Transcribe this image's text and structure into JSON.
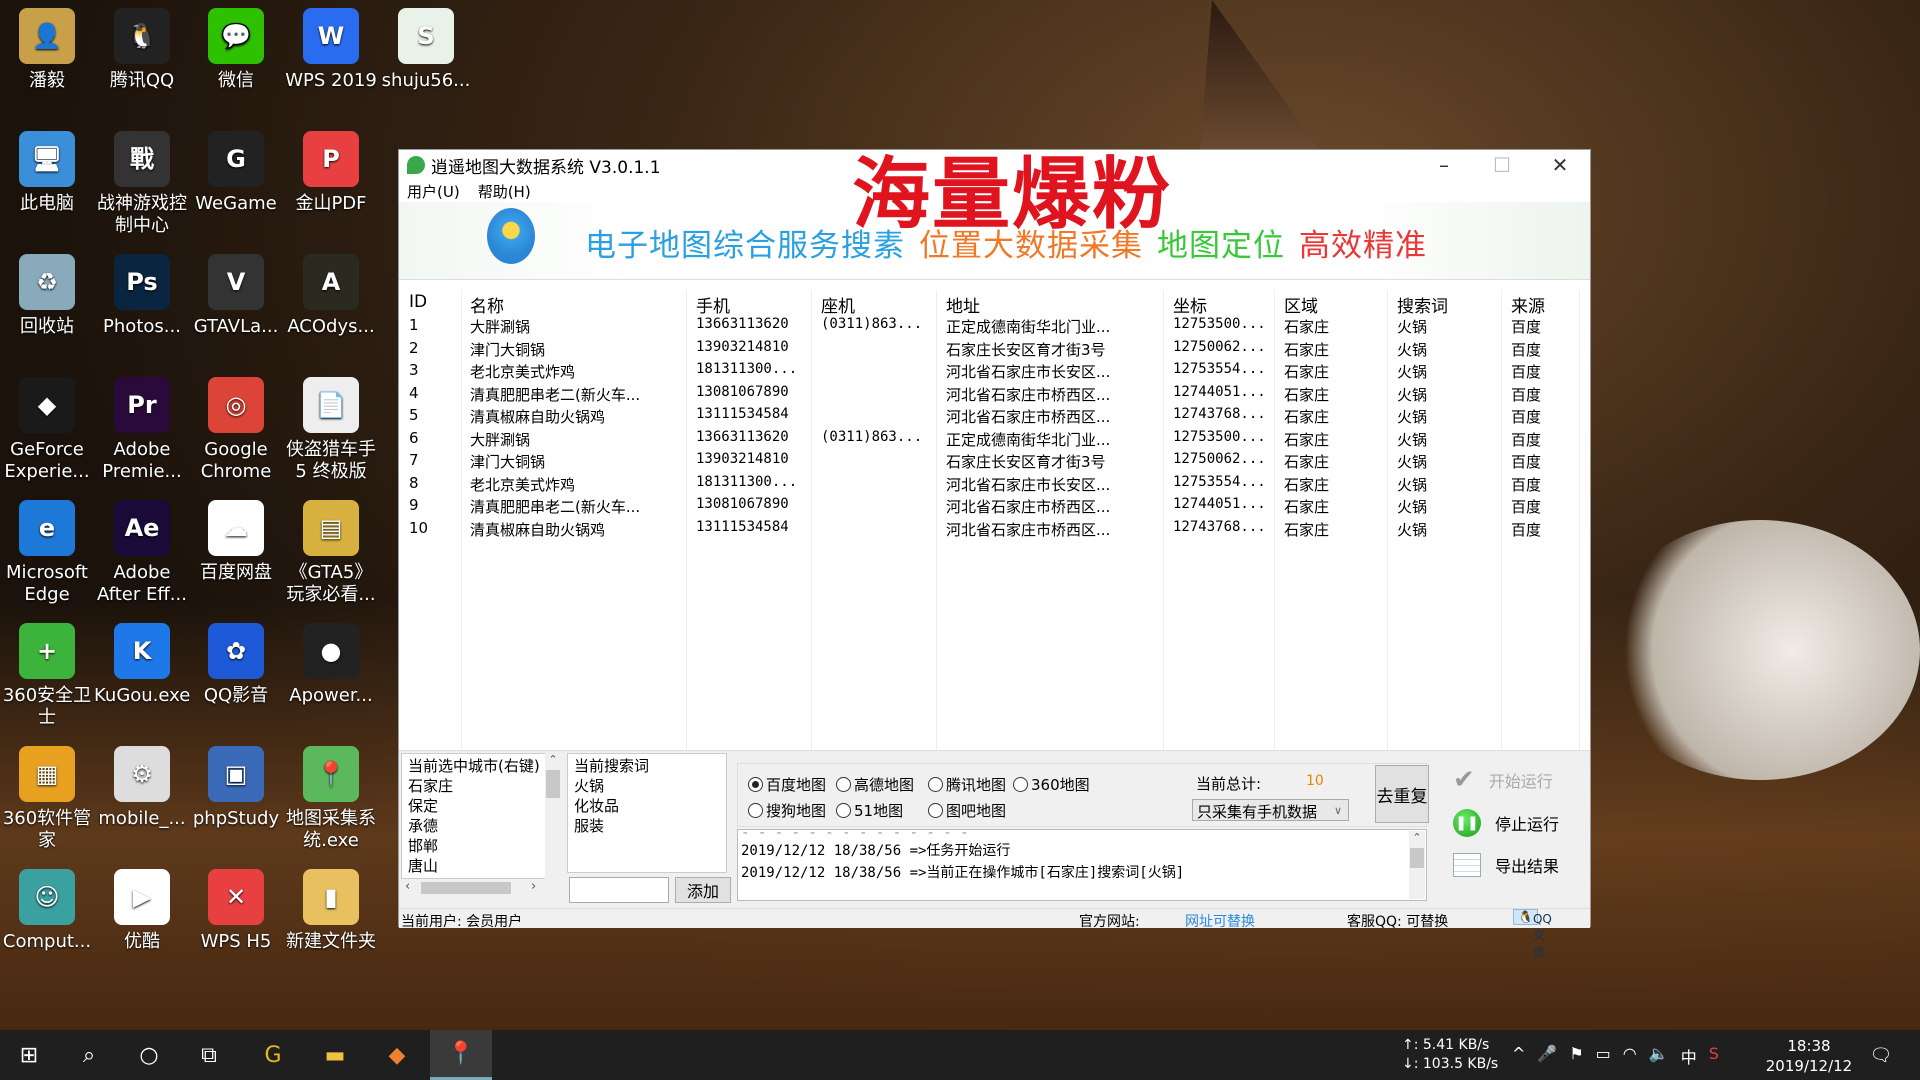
{
  "desktop_icons": [
    {
      "label": "潘毅",
      "color": "#c9a04a",
      "glyph": "👤"
    },
    {
      "label": "腾讯QQ",
      "color": "#222",
      "glyph": "🐧"
    },
    {
      "label": "微信",
      "color": "#2dc100",
      "glyph": "💬"
    },
    {
      "label": "WPS 2019",
      "color": "#2a6cf0",
      "glyph": "W"
    },
    {
      "label": "shuju56...",
      "color": "#e8f2e8",
      "glyph": "S"
    },
    {
      "label": "此电脑",
      "color": "#3a8fd8",
      "glyph": "🖥"
    },
    {
      "label": "战神游戏控制中心",
      "color": "#333",
      "glyph": "戰"
    },
    {
      "label": "WeGame",
      "color": "#222",
      "glyph": "G"
    },
    {
      "label": "金山PDF",
      "color": "#e84040",
      "glyph": "P"
    },
    {
      "label": "",
      "color": "",
      "glyph": ""
    },
    {
      "label": "回收站",
      "color": "#8ab",
      "glyph": "♻"
    },
    {
      "label": "Photos...",
      "color": "#0a2540",
      "glyph": "Ps"
    },
    {
      "label": "GTAVLa...",
      "color": "#333",
      "glyph": "V"
    },
    {
      "label": "ACOdys...",
      "color": "#2a2a20",
      "glyph": "A"
    },
    {
      "label": "",
      "color": "",
      "glyph": ""
    },
    {
      "label": "GeForce Experie...",
      "color": "#1a1a1a",
      "glyph": "◆"
    },
    {
      "label": "Adobe Premie...",
      "color": "#2a0a3a",
      "glyph": "Pr"
    },
    {
      "label": "Google Chrome",
      "color": "#db4437",
      "glyph": "◎"
    },
    {
      "label": "侠盗猎车手5 终极版",
      "color": "#eee",
      "glyph": "📄"
    },
    {
      "label": "",
      "color": "",
      "glyph": ""
    },
    {
      "label": "Microsoft Edge",
      "color": "#1e78d8",
      "glyph": "e"
    },
    {
      "label": "Adobe After Eff...",
      "color": "#1a0a3a",
      "glyph": "Ae"
    },
    {
      "label": "百度网盘",
      "color": "#fff",
      "glyph": "☁"
    },
    {
      "label": "《GTA5》玩家必看...",
      "color": "#d8b040",
      "glyph": "▤"
    },
    {
      "label": "",
      "color": "",
      "glyph": ""
    },
    {
      "label": "360安全卫士",
      "color": "#3cb43c",
      "glyph": "+"
    },
    {
      "label": "KuGou.exe",
      "color": "#1e78e8",
      "glyph": "K"
    },
    {
      "label": "QQ影音",
      "color": "#1e5ad8",
      "glyph": "✿"
    },
    {
      "label": "Apower...",
      "color": "#222",
      "glyph": "●"
    },
    {
      "label": "",
      "color": "",
      "glyph": ""
    },
    {
      "label": "360软件管家",
      "color": "#e8a020",
      "glyph": "▦"
    },
    {
      "label": "mobile_...",
      "color": "#ddd",
      "glyph": "⚙"
    },
    {
      "label": "phpStudy",
      "color": "#3a6ab8",
      "glyph": "▣"
    },
    {
      "label": "地图采集系统.exe",
      "color": "#5cb85c",
      "glyph": "📍"
    },
    {
      "label": "",
      "color": "",
      "glyph": ""
    },
    {
      "label": "Comput...",
      "color": "#3aa0a0",
      "glyph": "☺"
    },
    {
      "label": "优酷",
      "color": "#fff",
      "glyph": "▶"
    },
    {
      "label": "WPS H5",
      "color": "#e84040",
      "glyph": "✕"
    },
    {
      "label": "新建文件夹",
      "color": "#e8c060",
      "glyph": "▮"
    },
    {
      "label": "",
      "color": "",
      "glyph": ""
    }
  ],
  "window": {
    "title": "逍遥地图大数据系统 V3.0.1.1",
    "menu": [
      "用户(U)",
      "帮助(H)"
    ],
    "overlay_text": "海量爆粉",
    "slogans": [
      {
        "text": "电子地图综合服务搜素",
        "color": "#2aa0e0"
      },
      {
        "text": "位置大数据采集",
        "color": "#f07828"
      },
      {
        "text": "地图定位",
        "color": "#38c838"
      },
      {
        "text": "高效精准",
        "color": "#e83838"
      }
    ]
  },
  "table": {
    "columns": [
      "ID",
      "名称",
      "手机",
      "座机",
      "地址",
      "坐标",
      "区域",
      "搜索词",
      "来源"
    ],
    "rows": [
      [
        "1",
        "大胖涮锅",
        "13663113620",
        "(0311)863...",
        "正定成德南街华北门业...",
        "12753500...",
        "石家庄",
        "火锅",
        "百度"
      ],
      [
        "2",
        "津门大铜锅",
        "13903214810",
        "",
        "石家庄长安区育才街3号",
        "12750062...",
        "石家庄",
        "火锅",
        "百度"
      ],
      [
        "3",
        "老北京美式炸鸡",
        "181311300...",
        "",
        "河北省石家庄市长安区...",
        "12753554...",
        "石家庄",
        "火锅",
        "百度"
      ],
      [
        "4",
        "清真肥肥串老二(新火车...",
        "13081067890",
        "",
        "河北省石家庄市桥西区...",
        "12744051...",
        "石家庄",
        "火锅",
        "百度"
      ],
      [
        "5",
        "清真椒麻自助火锅鸡",
        "13111534584",
        "",
        "河北省石家庄市桥西区...",
        "12743768...",
        "石家庄",
        "火锅",
        "百度"
      ],
      [
        "6",
        "大胖涮锅",
        "13663113620",
        "(0311)863...",
        "正定成德南街华北门业...",
        "12753500...",
        "石家庄",
        "火锅",
        "百度"
      ],
      [
        "7",
        "津门大铜锅",
        "13903214810",
        "",
        "石家庄长安区育才街3号",
        "12750062...",
        "石家庄",
        "火锅",
        "百度"
      ],
      [
        "8",
        "老北京美式炸鸡",
        "181311300...",
        "",
        "河北省石家庄市长安区...",
        "12753554...",
        "石家庄",
        "火锅",
        "百度"
      ],
      [
        "9",
        "清真肥肥串老二(新火车...",
        "13081067890",
        "",
        "河北省石家庄市桥西区...",
        "12744051...",
        "石家庄",
        "火锅",
        "百度"
      ],
      [
        "10",
        "清真椒麻自助火锅鸡",
        "13111534584",
        "",
        "河北省石家庄市桥西区...",
        "12743768...",
        "石家庄",
        "火锅",
        "百度"
      ]
    ]
  },
  "cities": {
    "header": "当前选中城市(右键)",
    "items": [
      "石家庄",
      "保定",
      "承德",
      "邯郸",
      "唐山"
    ]
  },
  "keywords": {
    "header": "当前搜索词",
    "items": [
      "火锅",
      "化妆品",
      "服装"
    ],
    "input_value": "",
    "add_label": "添加"
  },
  "maps": {
    "options": [
      "百度地图",
      "高德地图",
      "腾讯地图",
      "360地图",
      "搜狗地图",
      "51地图",
      "图吧地图"
    ],
    "selected": "百度地图"
  },
  "total": {
    "label": "当前总计:",
    "value": "10",
    "filter": "只采集有手机数据",
    "dedupe_label": "去重复"
  },
  "log": [
    "2019/12/12 18/38/56 =>任务开始运行",
    "2019/12/12 18/38/56 =>当前正在操作城市[石家庄]搜索词[火锅]"
  ],
  "actions": {
    "start": "开始运行",
    "stop": "停止运行",
    "export": "导出结果"
  },
  "status": {
    "user": "当前用户: 会员用户",
    "site_label": "官方网站:",
    "site_link": "网址可替换",
    "qq": "客服QQ: 可替换",
    "qq_btn": "QQ交谈"
  },
  "taskbar": {
    "net_up": "↑: 5.41 KB/s",
    "net_down": "↓: 103.5 KB/s",
    "ime": "中",
    "time": "18:38",
    "date": "2019/12/12"
  }
}
